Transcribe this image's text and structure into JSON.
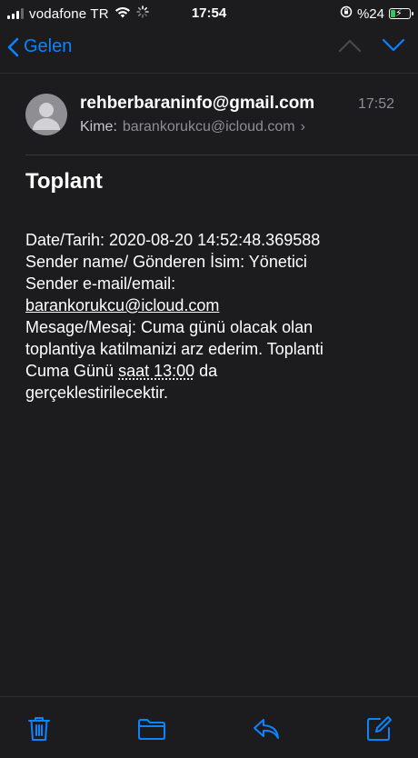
{
  "status_bar": {
    "carrier": "vodafone TR",
    "time": "17:54",
    "battery": "%24",
    "battery_level": 0.24,
    "battery_color": "#34c759"
  },
  "nav": {
    "back_label": "Gelen",
    "back_icon": "chevron-left-icon",
    "prev_icon": "chevron-up-icon",
    "next_icon": "chevron-down-icon",
    "accent": "#0a84ff"
  },
  "message": {
    "sender": "rehberbaraninfo@gmail.com",
    "time": "17:52",
    "to_label": "Kime:",
    "to": "barankorukcu@icloud.com",
    "subject": "Toplant",
    "body": {
      "date_line": "Date/Tarih: 2020-08-20 14:52:48.369588",
      "sender_name_line": "Sender name/ Gönderen İsim: Yönetici",
      "sender_email_label": "Sender e-mail/email:",
      "sender_email": "barankorukcu@icloud.com",
      "message_line_1": "Mesage/Mesaj: Cuma günü olacak olan",
      "message_line_2": "toplantiya katilmanizi arz ederim. Toplanti",
      "message_line_3_a": "Cuma Günü ",
      "message_line_3_time": "saat 13:00",
      "message_line_3_b": " da",
      "message_line_4": "gerçeklestirilecektir."
    }
  },
  "toolbar": {
    "icons": [
      "trash-icon",
      "folder-icon",
      "reply-icon",
      "compose-icon"
    ]
  }
}
